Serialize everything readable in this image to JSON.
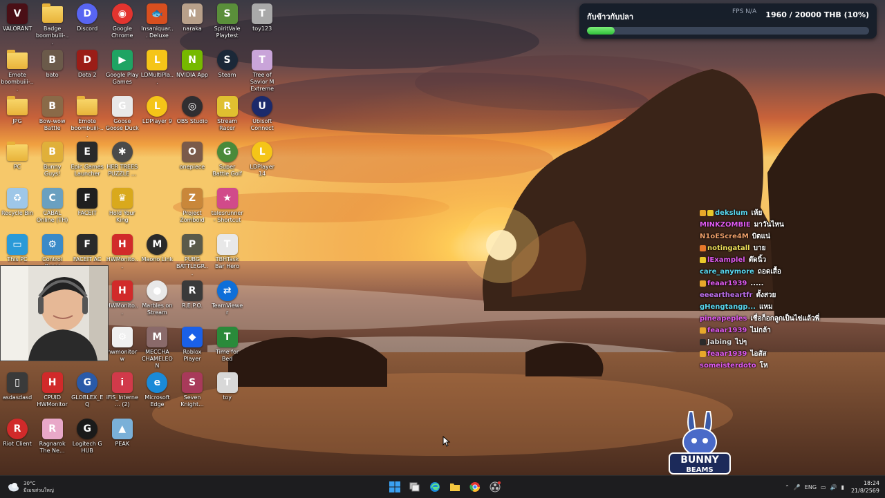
{
  "desktop": {
    "icons": [
      {
        "label": "VALORANT",
        "kind": "app",
        "color": "#4a0f16",
        "glyph": "V",
        "col": 0,
        "row": 0
      },
      {
        "label": "Badge boombuiii-...",
        "kind": "folder",
        "col": 1,
        "row": 0
      },
      {
        "label": "Discord",
        "kind": "app",
        "color": "#5865f2",
        "glyph": "D",
        "col": 2,
        "row": 0,
        "round": true
      },
      {
        "label": "Google Chrome",
        "kind": "app",
        "color": "#e3342f",
        "glyph": "◉",
        "col": 3,
        "row": 0,
        "round": true
      },
      {
        "label": "Insaniquar... Deluxe",
        "kind": "app",
        "color": "#d84f1f",
        "glyph": "🐟",
        "col": 4,
        "row": 0
      },
      {
        "label": "naraka",
        "kind": "app",
        "color": "#b8a08a",
        "glyph": "N",
        "col": 5,
        "row": 0
      },
      {
        "label": "SpiritVale Playtest",
        "kind": "app",
        "color": "#5a8f3a",
        "glyph": "S",
        "col": 6,
        "row": 0
      },
      {
        "label": "toy123",
        "kind": "app",
        "color": "#a9a9a9",
        "glyph": "T",
        "col": 7,
        "row": 0
      },
      {
        "label": "Emote boombuiii-...",
        "kind": "folder",
        "col": 0,
        "row": 1
      },
      {
        "label": "bato",
        "kind": "app",
        "color": "#6b5a4a",
        "glyph": "B",
        "col": 1,
        "row": 1
      },
      {
        "label": "Dota 2",
        "kind": "app",
        "color": "#9b1d17",
        "glyph": "D",
        "col": 2,
        "row": 1
      },
      {
        "label": "Google Play Games",
        "kind": "app",
        "color": "#1fa463",
        "glyph": "▶",
        "col": 3,
        "row": 1
      },
      {
        "label": "LDMultiPla...",
        "kind": "app",
        "color": "#f5c518",
        "glyph": "L",
        "col": 4,
        "row": 1
      },
      {
        "label": "NVIDIA App",
        "kind": "app",
        "color": "#76b900",
        "glyph": "N",
        "col": 5,
        "row": 1
      },
      {
        "label": "Steam",
        "kind": "app",
        "color": "#1b2838",
        "glyph": "S",
        "col": 6,
        "row": 1,
        "round": true
      },
      {
        "label": "Tree of Savior M Extreme",
        "kind": "app",
        "color": "#c9a4d9",
        "glyph": "T",
        "col": 7,
        "row": 1
      },
      {
        "label": "JPG",
        "kind": "folder",
        "col": 0,
        "row": 2
      },
      {
        "label": "Bow-wow Battle",
        "kind": "app",
        "color": "#8a6a48",
        "glyph": "B",
        "col": 1,
        "row": 2
      },
      {
        "label": "Emote boombuiii-...",
        "kind": "folder",
        "col": 2,
        "row": 2
      },
      {
        "label": "Goose Goose Duck",
        "kind": "app",
        "color": "#e8e8e8",
        "glyph": "G",
        "col": 3,
        "row": 2
      },
      {
        "label": "LDPlayer 9",
        "kind": "app",
        "color": "#f5c518",
        "glyph": "L",
        "col": 4,
        "row": 2,
        "round": true
      },
      {
        "label": "OBS Studio",
        "kind": "app",
        "color": "#302e31",
        "glyph": "◎",
        "col": 5,
        "row": 2,
        "round": true
      },
      {
        "label": "Stream Racer",
        "kind": "app",
        "color": "#e0c030",
        "glyph": "R",
        "col": 6,
        "row": 2
      },
      {
        "label": "Ubisoft Connect",
        "kind": "app",
        "color": "#1b2a6b",
        "glyph": "U",
        "col": 7,
        "row": 2,
        "round": true
      },
      {
        "label": "PC",
        "kind": "folder",
        "col": 0,
        "row": 3
      },
      {
        "label": "Bunny Guys!",
        "kind": "app",
        "color": "#e0b03a",
        "glyph": "B",
        "col": 1,
        "row": 3
      },
      {
        "label": "Epic Games Launcher",
        "kind": "app",
        "color": "#2a2a2a",
        "glyph": "E",
        "col": 2,
        "row": 3
      },
      {
        "label": "HER TREES PUZZLE ...",
        "kind": "app",
        "color": "#4a4a4a",
        "glyph": "✱",
        "col": 3,
        "row": 3,
        "round": true
      },
      {
        "label": "onepiece",
        "kind": "app",
        "color": "#7a5a4a",
        "glyph": "O",
        "col": 5,
        "row": 3
      },
      {
        "label": "Super Battle Golf",
        "kind": "app",
        "color": "#4a8a3a",
        "glyph": "G",
        "col": 6,
        "row": 3,
        "round": true
      },
      {
        "label": "LDPlayer 14",
        "kind": "app",
        "color": "#f5c518",
        "glyph": "L",
        "col": 7,
        "row": 3,
        "round": true
      },
      {
        "label": "Recycle Bin",
        "kind": "app",
        "color": "#9ec7e8",
        "glyph": "♻",
        "col": 0,
        "row": 4
      },
      {
        "label": "CABAL Online (TH)",
        "kind": "app",
        "color": "#6aa0c0",
        "glyph": "C",
        "col": 1,
        "row": 4
      },
      {
        "label": "FACEIT",
        "kind": "app",
        "color": "#1f1f1f",
        "glyph": "F",
        "col": 2,
        "row": 4
      },
      {
        "label": "Hold Your King",
        "kind": "app",
        "color": "#d9a91c",
        "glyph": "♛",
        "col": 3,
        "row": 4
      },
      {
        "label": "Project Zomboid",
        "kind": "app",
        "color": "#c9873a",
        "glyph": "Z",
        "col": 5,
        "row": 4
      },
      {
        "label": "talesrunner - Shortcut",
        "kind": "app",
        "color": "#d14a8a",
        "glyph": "★",
        "col": 6,
        "row": 4
      },
      {
        "label": "This PC",
        "kind": "app",
        "color": "#2a9ad8",
        "glyph": "▭",
        "col": 0,
        "row": 5
      },
      {
        "label": "Control Panel",
        "kind": "app",
        "color": "#3a8ac8",
        "glyph": "⚙",
        "col": 1,
        "row": 5
      },
      {
        "label": "FACEIT AC",
        "kind": "app",
        "color": "#2a2a2a",
        "glyph": "F",
        "col": 2,
        "row": 5
      },
      {
        "label": "HWMonito...",
        "kind": "app",
        "color": "#d12a2a",
        "glyph": "H",
        "col": 3,
        "row": 5
      },
      {
        "label": "Maono Link",
        "kind": "app",
        "color": "#2a2a2a",
        "glyph": "M",
        "col": 4,
        "row": 5,
        "round": true
      },
      {
        "label": "PUBG BATTLEGR...",
        "kind": "app",
        "color": "#5a5a4a",
        "glyph": "P",
        "col": 5,
        "row": 5
      },
      {
        "label": "TBHTask Bar Hero",
        "kind": "app",
        "color": "#e8e8e8",
        "glyph": "T",
        "col": 6,
        "row": 5
      },
      {
        "label": "HWMonito...",
        "kind": "app",
        "color": "#d12a2a",
        "glyph": "H",
        "col": 3,
        "row": 6
      },
      {
        "label": "Marbles on Stream",
        "kind": "app",
        "color": "#e8e8e8",
        "glyph": "●",
        "col": 4,
        "row": 6,
        "round": true
      },
      {
        "label": "R.E.P.O.",
        "kind": "app",
        "color": "#3a3a3a",
        "glyph": "R",
        "col": 5,
        "row": 6
      },
      {
        "label": "TeamViewer",
        "kind": "app",
        "color": "#0e6fd9",
        "glyph": "⇄",
        "col": 6,
        "row": 6,
        "round": true
      },
      {
        "label": "hwmonitorw",
        "kind": "app",
        "color": "#f0f0f0",
        "glyph": "⚙",
        "col": 3,
        "row": 7
      },
      {
        "label": "MECCHA CHAMELEON",
        "kind": "app",
        "color": "#8a6a6a",
        "glyph": "M",
        "col": 4,
        "row": 7
      },
      {
        "label": "Roblox Player",
        "kind": "app",
        "color": "#1a60e8",
        "glyph": "◆",
        "col": 5,
        "row": 7
      },
      {
        "label": "Time for Bed",
        "kind": "app",
        "color": "#2a8a3a",
        "glyph": "T",
        "col": 6,
        "row": 7
      },
      {
        "label": "asdasdasd",
        "kind": "app",
        "color": "#3a3a3a",
        "glyph": "▯",
        "col": 0,
        "row": 8
      },
      {
        "label": "CPUID HWMonitor",
        "kind": "app",
        "color": "#d12a2a",
        "glyph": "H",
        "col": 1,
        "row": 8
      },
      {
        "label": "GLOBLEX_EQ",
        "kind": "app",
        "color": "#2a5aa8",
        "glyph": "G",
        "col": 2,
        "row": 8,
        "round": true
      },
      {
        "label": "iFiS_Interne... (2)",
        "kind": "app",
        "color": "#d13a4a",
        "glyph": "i",
        "col": 3,
        "row": 8
      },
      {
        "label": "Microsoft Edge",
        "kind": "app",
        "color": "#1a8ad8",
        "glyph": "e",
        "col": 4,
        "row": 8,
        "round": true
      },
      {
        "label": "Seven Knight...",
        "kind": "app",
        "color": "#a83a5a",
        "glyph": "S",
        "col": 5,
        "row": 8
      },
      {
        "label": "toy",
        "kind": "app",
        "color": "#d8d8d8",
        "glyph": "T",
        "col": 6,
        "row": 8
      },
      {
        "label": "Riot Client",
        "kind": "app",
        "color": "#d12a2a",
        "glyph": "R",
        "col": 0,
        "row": 9,
        "round": true
      },
      {
        "label": "Ragnarok The Ne...",
        "kind": "app",
        "color": "#e8a8c8",
        "glyph": "R",
        "col": 1,
        "row": 9
      },
      {
        "label": "Logitech G HUB",
        "kind": "app",
        "color": "#1a1a1a",
        "glyph": "G",
        "col": 2,
        "row": 9,
        "round": true
      },
      {
        "label": "PEAK",
        "kind": "app",
        "color": "#7ab0d8",
        "glyph": "▲",
        "col": 3,
        "row": 9
      }
    ]
  },
  "goal": {
    "title": "กับข้าวกับปลา",
    "amount": "1960 / 20000 THB (10%)",
    "progress": 0.098,
    "stats": "FPS N/A"
  },
  "chat": [
    {
      "name": "dekslum",
      "msg": "เห้ย",
      "color": "#5ad8f0",
      "badges": [
        "#e8a82a",
        "#e8c82a"
      ]
    },
    {
      "name": "MINKZOMBIE",
      "msg": "มาวันไหน",
      "color": "#e05af0",
      "badges": []
    },
    {
      "name": "N1oEScre4M",
      "msg": "บิดแน่",
      "color": "#f0a06a",
      "badges": []
    },
    {
      "name": "notingatall",
      "msg": "บาย",
      "color": "#f0e05a",
      "badges": [
        "#e8782a"
      ]
    },
    {
      "name": "lExamplel",
      "msg": "ต๊ดนิ้ว",
      "color": "#e05af0",
      "badges": [
        "#e8c82a"
      ]
    },
    {
      "name": "care_anymore",
      "msg": "ถอดเสื้อ",
      "color": "#5ad8f0",
      "badges": []
    },
    {
      "name": "feaar1939",
      "msg": ".....",
      "color": "#e05af0",
      "badges": [
        "#e8a82a"
      ]
    },
    {
      "name": "eeeartheartfr",
      "msg": "ตั้งสวย",
      "color": "#c070f0",
      "badges": []
    },
    {
      "name": "gHengtangp...",
      "msg": "แหม",
      "color": "#5ad8f0",
      "badges": []
    },
    {
      "name": "pineapeples",
      "msg": "เชื่อก็อกลูกเป็นไข่แล้วพี่",
      "color": "#e05af0",
      "badges": []
    },
    {
      "name": "feaar1939",
      "msg": "ไม่กล้า",
      "color": "#e05af0",
      "badges": [
        "#e8a82a"
      ]
    },
    {
      "name": "Jabing",
      "msg": "ไปๆ",
      "color": "#e0e0e0",
      "badges": [
        "#2a2a2a"
      ]
    },
    {
      "name": "feaar1939",
      "msg": "ไอสัส",
      "color": "#e05af0",
      "badges": [
        "#e8a82a"
      ]
    },
    {
      "name": "someisterdoto",
      "msg": "โห",
      "color": "#e05af0",
      "badges": []
    }
  ],
  "logo": {
    "line1": "BUNNY",
    "line2": "BEAMS"
  },
  "taskbar": {
    "weather_temp": "30°C",
    "weather_desc": "มีเมฆส่วนใหญ่",
    "lang": "ENG",
    "time": "18:24",
    "date": "21/8/2569",
    "pinned": [
      "start-icon",
      "task-view-icon",
      "edge-icon",
      "file-explorer-icon",
      "chrome-icon",
      "obs-icon"
    ]
  }
}
